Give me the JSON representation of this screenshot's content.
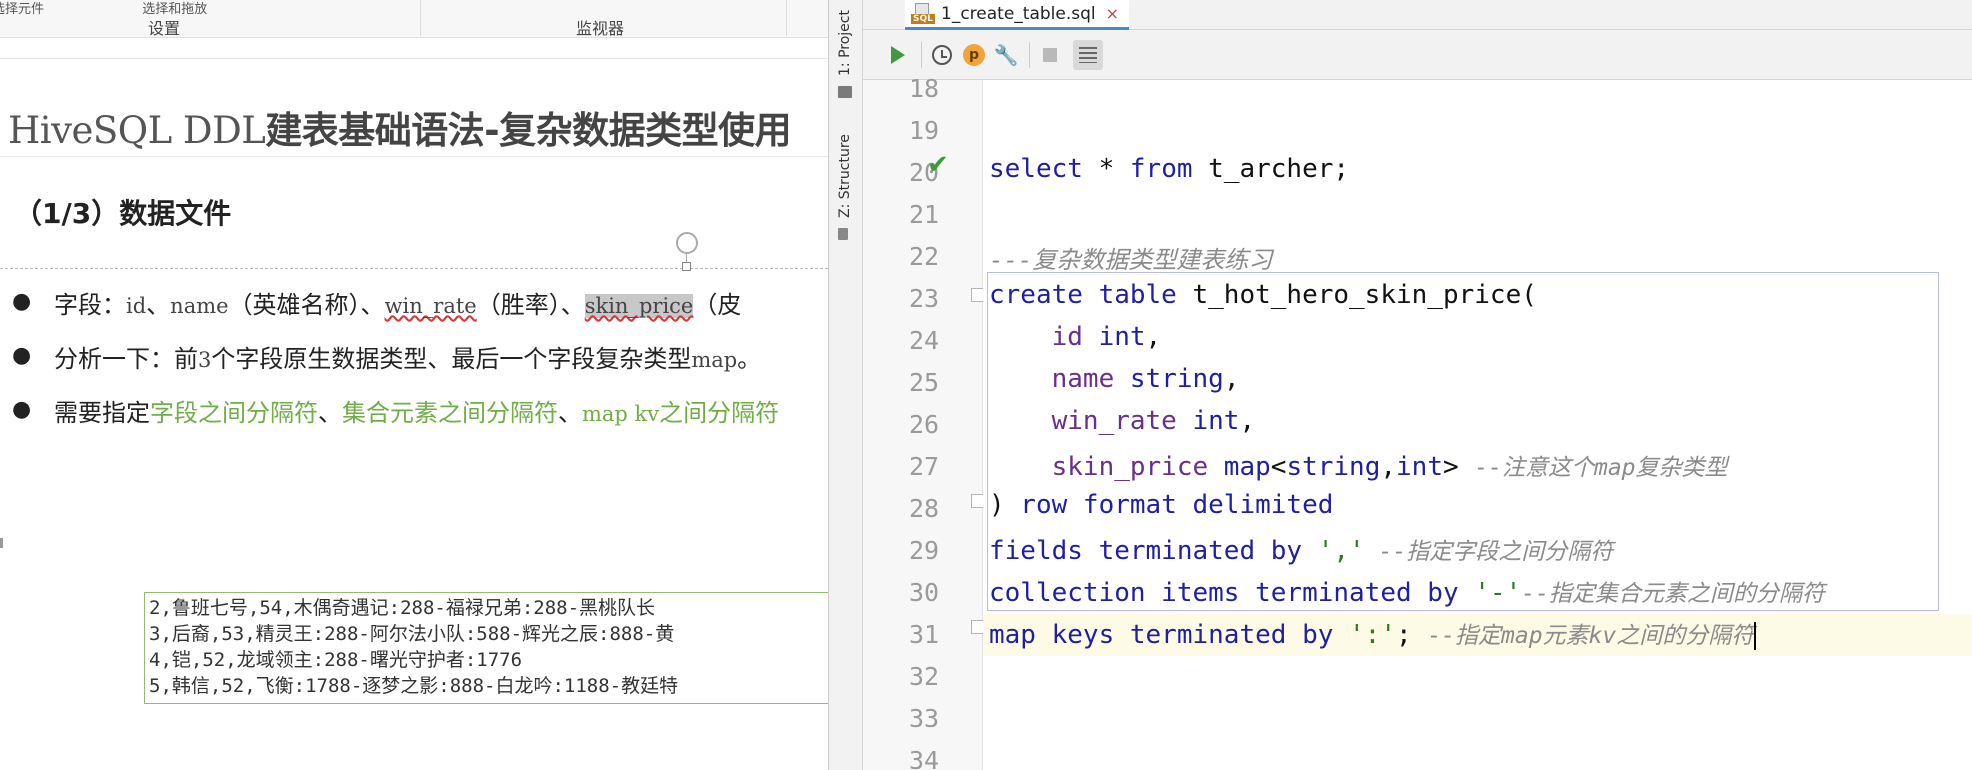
{
  "ppt": {
    "ribbon": {
      "top_left": "选择元件",
      "top_mid": "选择和拖放",
      "group_settings": "设置",
      "group_monitor": "监视器"
    },
    "title_mono": "HiveSQL DDL",
    "title_rest": "建表基础语法-复杂数据类型使用",
    "subtitle": "（1/3）数据文件",
    "bullets": {
      "b1_prefix": "字段：",
      "b1_f1": "id",
      "b1_s1": "、",
      "b1_f2": "name",
      "b1_s2": "（英雄名称）、",
      "b1_f3": "win_rate",
      "b1_s3": "（胜率）、",
      "b1_f4": "skin_price",
      "b1_s4": "（皮",
      "b2_a": "分析一下：前",
      "b2_n": "3",
      "b2_b": "个字段原生数据类型、最后一个字段复杂类型",
      "b2_m": "map",
      "b2_c": "。",
      "b3_a": "需要指定",
      "b3_g1": "字段之间分隔符",
      "b3_s1": "、",
      "b3_g2": "集合元素之间分隔符",
      "b3_s2": "、",
      "b3_g3a": "map kv",
      "b3_g3b": "之间分隔符"
    },
    "data_rows": [
      "2,鲁班七号,54,木偶奇遇记:288-福禄兄弟:288-黑桃队长",
      "3,后裔,53,精灵王:288-阿尔法小队:588-辉光之辰:888-黄",
      "4,铠,52,龙域领主:288-曙光守护者:1776",
      "5,韩信,52,飞衡:1788-逐梦之影:888-白龙吟:1188-教廷特"
    ]
  },
  "ide": {
    "side_project": "1: Project",
    "side_structure": "Z: Structure",
    "tab_badge": "SQL",
    "tab_label": "1_create_table.sql",
    "tab_close": "×",
    "p_label": "p",
    "wrench": "🔧",
    "check": "✔",
    "line_numbers": [
      "18",
      "19",
      "20",
      "21",
      "22",
      "23",
      "24",
      "25",
      "26",
      "27",
      "28",
      "29",
      "30",
      "31",
      "32",
      "33",
      "34"
    ],
    "code": {
      "l20_kw1": "select",
      "l20_rest": " * ",
      "l20_kw2": "from",
      "l20_tail": " t_archer;",
      "l22_cm": "---复杂数据类型建表练习",
      "l23_kw": "create table",
      "l23_tail": " t_hot_hero_skin_price(",
      "l24_col": "    id",
      "l24_type": " int",
      "l24_tail": ",",
      "l25_col": "    name",
      "l25_type": " string",
      "l25_tail": ",",
      "l26_col": "    win_rate",
      "l26_type": " int",
      "l26_tail": ",",
      "l27_col": "    skin_price",
      "l27_type1": " map",
      "l27_lt": "<",
      "l27_type2": "string",
      "l27_comma": ",",
      "l27_type3": "int",
      "l27_gt": "> ",
      "l27_cm": "--注意这个map复杂类型",
      "l28_paren": ")",
      "l28_kw": " row format delimited",
      "l29_kw": "fields terminated by ",
      "l29_str": "','",
      "l29_cm": " --指定字段之间分隔符",
      "l30_kw": "collection items terminated by ",
      "l30_str": "'-'",
      "l30_cm": "--指定集合元素之间的分隔符",
      "l31_kw": "map keys terminated by ",
      "l31_str": "':'",
      "l31_semi": "; ",
      "l31_cm": "--指定map元素kv之间的分隔符"
    }
  }
}
